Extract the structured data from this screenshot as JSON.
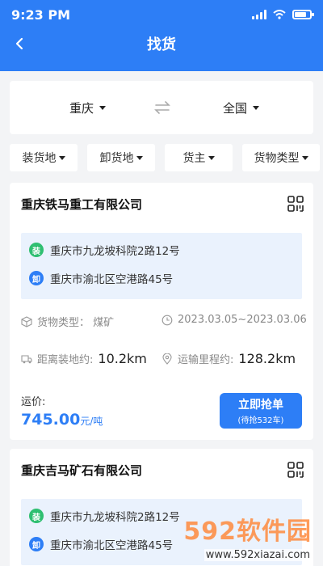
{
  "status_bar": {
    "time": "9:23 PM"
  },
  "nav": {
    "title": "找货"
  },
  "route": {
    "from": "重庆",
    "to": "全国"
  },
  "filters": [
    {
      "label": "装货地"
    },
    {
      "label": "卸货地"
    },
    {
      "label": "货主"
    },
    {
      "label": "货物类型"
    }
  ],
  "cards": [
    {
      "company": "重庆铁马重工有限公司",
      "load_badge": "装",
      "load_addr": "重庆市九龙坡科院2路12号",
      "unload_badge": "卸",
      "unload_addr": "重庆市渝北区空港路45号",
      "cargo_type": "货物类型：  煤矿",
      "date_range": "2023.03.05~2023.03.06",
      "distance_label": "距离装地约:",
      "distance_value": "10.2km",
      "transport_label": "运输里程约:",
      "transport_value": "128.2km",
      "price_label": "运价:",
      "price_value": "745.00",
      "price_unit": "元/吨",
      "grab_label": "立即抢单",
      "grab_sub": "(待抢532车)"
    },
    {
      "company": "重庆吉马矿石有限公司",
      "load_badge": "装",
      "load_addr": "重庆市九龙坡科院2路12号",
      "unload_badge": "卸",
      "unload_addr": "重庆市渝北区空港路45号"
    }
  ],
  "watermark": {
    "main": "592软件园",
    "url": "www.592xiazai.com"
  },
  "colors": {
    "primary": "#2d7ef6",
    "load": "#2fbf71",
    "light_bg": "#eaf2fd"
  },
  "icons": [
    "back-arrow-icon",
    "swap-icon",
    "qr-code-icon",
    "cube-icon",
    "clock-icon",
    "truck-icon",
    "location-pin-icon"
  ]
}
